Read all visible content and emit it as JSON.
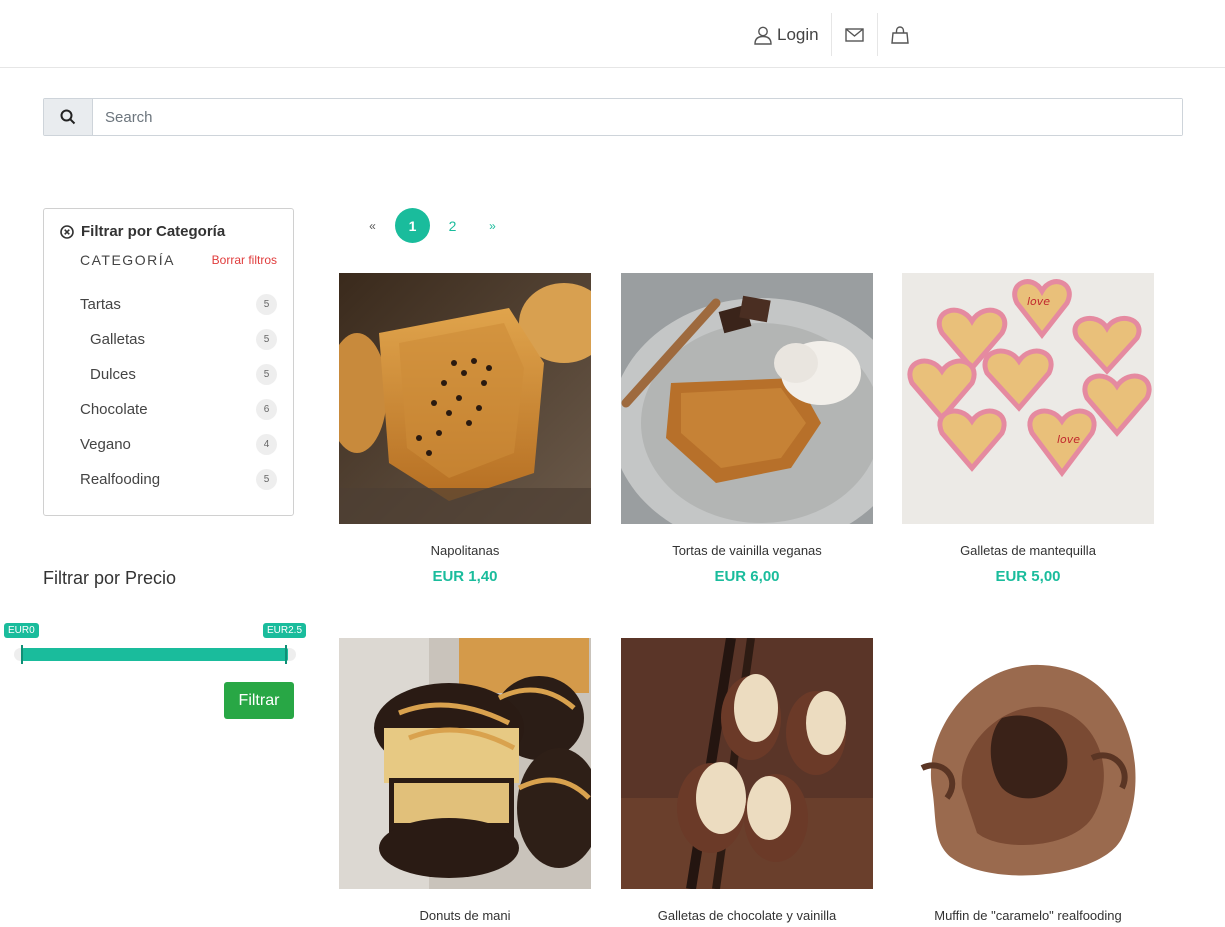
{
  "header": {
    "login_label": "Login"
  },
  "search": {
    "placeholder": "Search",
    "value": ""
  },
  "categories": {
    "title": "Filtrar por Categoría",
    "heading": "CATEGORÍA",
    "clear_label": "Borrar filtros",
    "items": [
      {
        "label": "Tartas",
        "count": "5"
      },
      {
        "label": "Galletas",
        "count": "5"
      },
      {
        "label": "Dulces",
        "count": "5"
      },
      {
        "label": "Chocolate",
        "count": "6"
      },
      {
        "label": "Vegano",
        "count": "4"
      },
      {
        "label": "Realfooding",
        "count": "5"
      }
    ]
  },
  "price_filter": {
    "title": "Filtrar por Precio",
    "min_label": "EUR0",
    "max_label": "EUR2.5",
    "button_label": "Filtrar"
  },
  "pagination": {
    "prev": "«",
    "pages": [
      "1",
      "2"
    ],
    "current": "1",
    "next": "»"
  },
  "products": [
    {
      "name": "Napolitanas",
      "price": "EUR 1,40"
    },
    {
      "name": "Tortas de vainilla veganas",
      "price": "EUR 6,00"
    },
    {
      "name": "Galletas de mantequilla",
      "price": "EUR 5,00"
    },
    {
      "name": "Donuts de mani",
      "price": ""
    },
    {
      "name": "Galletas de chocolate y vainilla",
      "price": ""
    },
    {
      "name": "Muffin de \"caramelo\" realfooding",
      "price": ""
    }
  ],
  "colors": {
    "accent": "#1abc9c",
    "filter_button": "#28a745",
    "clear_link": "#e03c3c"
  }
}
